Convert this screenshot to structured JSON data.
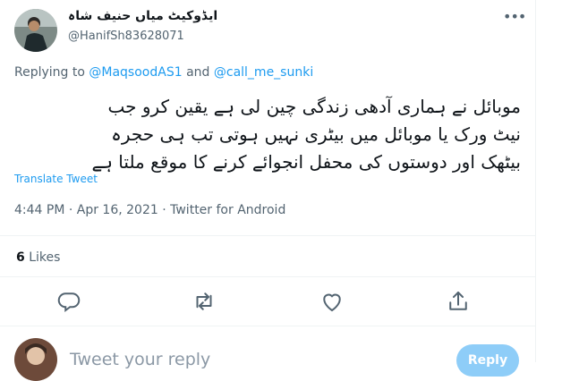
{
  "tweet": {
    "author_name": "ایڈوکیٹ میاں حنیف شاہ",
    "author_handle": "@HanifSh83628071",
    "more_icon": "more-dots-icon",
    "replying_prefix": "Replying to",
    "replying_user1": "@MaqsoodAS1",
    "replying_and": "and",
    "replying_user2": "@call_me_sunki",
    "text_lines": [
      "موبائل نے ہماری آدھی زندگی چین لی ہے یقین کرو جب",
      "نیٹ ورک یا موبائل میں بیٹری نہیں ہوتی تب ہی حجرہ",
      "بیٹھک اور دوستوں کی محفل انجوائے کرنے کا موقع ملتا ہے"
    ],
    "translate_label": "Translate Tweet",
    "timestamp": "4:44 PM · Apr 16, 2021 · Twitter for Android",
    "likes_count": "6",
    "likes_label": "Likes"
  },
  "actions": {
    "reply_icon": "reply-icon",
    "retweet_icon": "retweet-icon",
    "like_icon": "heart-icon",
    "share_icon": "share-icon"
  },
  "compose": {
    "placeholder": "Tweet your reply",
    "reply_button": "Reply"
  },
  "colors": {
    "accent": "#1d9bf0",
    "secondary_text": "#536471",
    "reply_button_disabled": "#8ecdf8"
  }
}
